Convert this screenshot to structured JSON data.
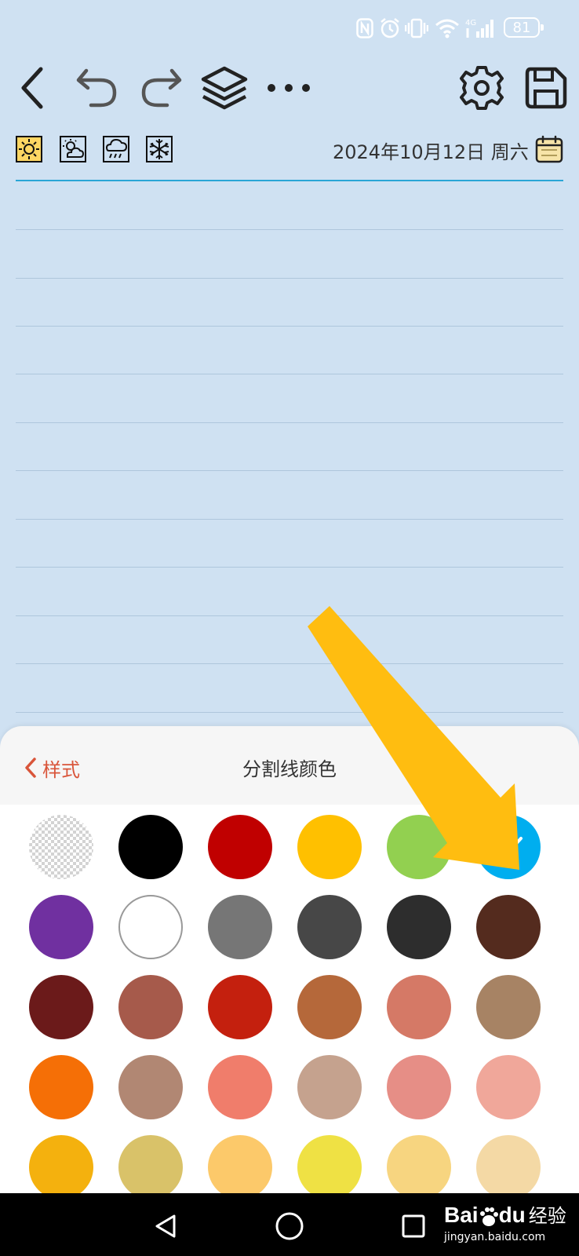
{
  "status_bar": {
    "network": "4G",
    "battery": "81",
    "icons": [
      "nfc-icon",
      "alarm-icon",
      "vibrate-icon",
      "wifi-icon",
      "signal-icon",
      "battery-icon"
    ]
  },
  "toolbar": {
    "buttons": [
      "back-icon",
      "undo-icon",
      "redo-icon",
      "layers-icon",
      "more-icon",
      "gear-icon",
      "save-icon"
    ]
  },
  "weather": {
    "options": [
      "sun-icon",
      "partly-cloudy-icon",
      "rain-icon",
      "snow-icon"
    ],
    "selected": "sun-icon",
    "selected_color": "#fdd663"
  },
  "date": {
    "label": "2024年10月12日 周六"
  },
  "sheet": {
    "back_label": "样式",
    "title": "分割线颜色",
    "accent_color": "#d9553a"
  },
  "palette": {
    "selected_color": "#00aeef",
    "rows": [
      [
        "transparent",
        "#000000",
        "#c00000",
        "#ffc000",
        "#92d050",
        "#00aeef"
      ],
      [
        "#7030a0",
        "#ffffff",
        "#767676",
        "#474747",
        "#2d2d2d",
        "#542b1e"
      ],
      [
        "#6b1a1a",
        "#a65a4b",
        "#c4200e",
        "#b5683a",
        "#d57966",
        "#a78364"
      ],
      [
        "#f56f06",
        "#b18773",
        "#f07d6b",
        "#c5a28e",
        "#e68e86",
        "#f0a79a"
      ],
      [
        "#f4b10e",
        "#d9c269",
        "#fcc96a",
        "#efe144",
        "#f7d580",
        "#f4d9a5"
      ]
    ]
  },
  "overlay": {
    "arrow_color": "#ffbd10"
  },
  "watermark": {
    "brand": "Bai",
    "brand2": "du",
    "product": "经验",
    "url": "jingyan.baidu.com"
  }
}
